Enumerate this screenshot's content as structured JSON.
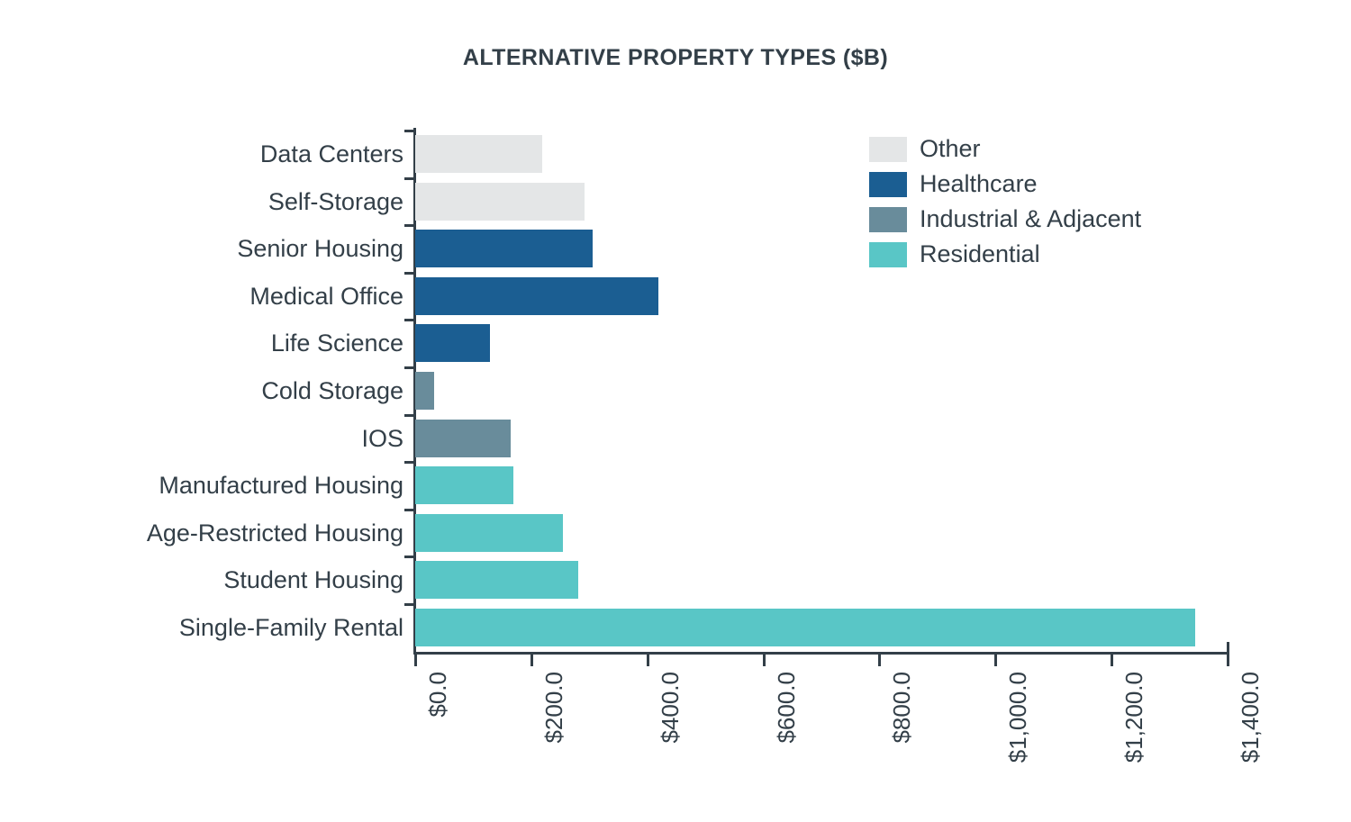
{
  "chart_data": {
    "type": "bar",
    "orientation": "horizontal",
    "title": "ALTERNATIVE PROPERTY TYPES ($B)",
    "xlabel": "",
    "ylabel": "",
    "xlim": [
      0,
      1400
    ],
    "grid": false,
    "legend_position": "top-right",
    "categories": [
      "Data Centers",
      "Self-Storage",
      "Senior Housing",
      "Medical Office",
      "Life Science",
      "Cold Storage",
      "IOS",
      "Manufactured Housing",
      "Age-Restricted Housing",
      "Student Housing",
      "Single-Family Rental"
    ],
    "values": [
      219,
      292,
      306,
      419,
      129,
      33,
      165,
      169,
      255,
      281,
      1344
    ],
    "point_groups": [
      "Other",
      "Other",
      "Healthcare",
      "Healthcare",
      "Healthcare",
      "Industrial & Adjacent",
      "Industrial & Adjacent",
      "Residential",
      "Residential",
      "Residential",
      "Residential"
    ],
    "xticks": [
      0,
      200,
      400,
      600,
      800,
      1000,
      1200,
      1400
    ],
    "xtick_labels": [
      "$0.0",
      "$200.0",
      "$400.0",
      "$600.0",
      "$800.0",
      "$1,000.0",
      "$1,200.0",
      "$1,400.0"
    ],
    "legend": [
      {
        "label": "Other",
        "color": "#e4e6e7"
      },
      {
        "label": "Healthcare",
        "color": "#1b5e92"
      },
      {
        "label": "Industrial & Adjacent",
        "color": "#698c9b"
      },
      {
        "label": "Residential",
        "color": "#59c6c6"
      }
    ]
  },
  "colors": {
    "other": "#e4e6e7",
    "healthcare": "#1b5e92",
    "industrial": "#698c9b",
    "residential": "#59c6c6",
    "axis": "#333f48",
    "text": "#333f48",
    "background": "#ffffff"
  }
}
